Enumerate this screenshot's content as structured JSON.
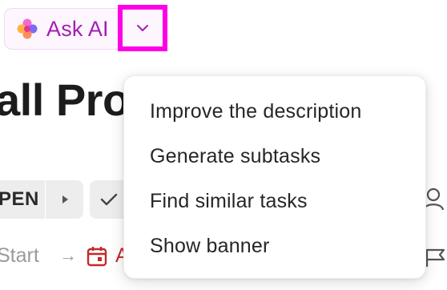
{
  "ask_ai": {
    "label": "Ask AI",
    "toggle_icon": "chevron-down-icon",
    "accent_color": "#a21fb3",
    "highlight_color": "#ff00e6"
  },
  "task": {
    "title": "all Proj",
    "status": "PEN",
    "start_label": "Start",
    "due_label": "A"
  },
  "menu": {
    "items": [
      {
        "label": "Improve the description"
      },
      {
        "label": "Generate subtasks"
      },
      {
        "label": "Find similar tasks"
      },
      {
        "label": "Show banner"
      }
    ]
  }
}
